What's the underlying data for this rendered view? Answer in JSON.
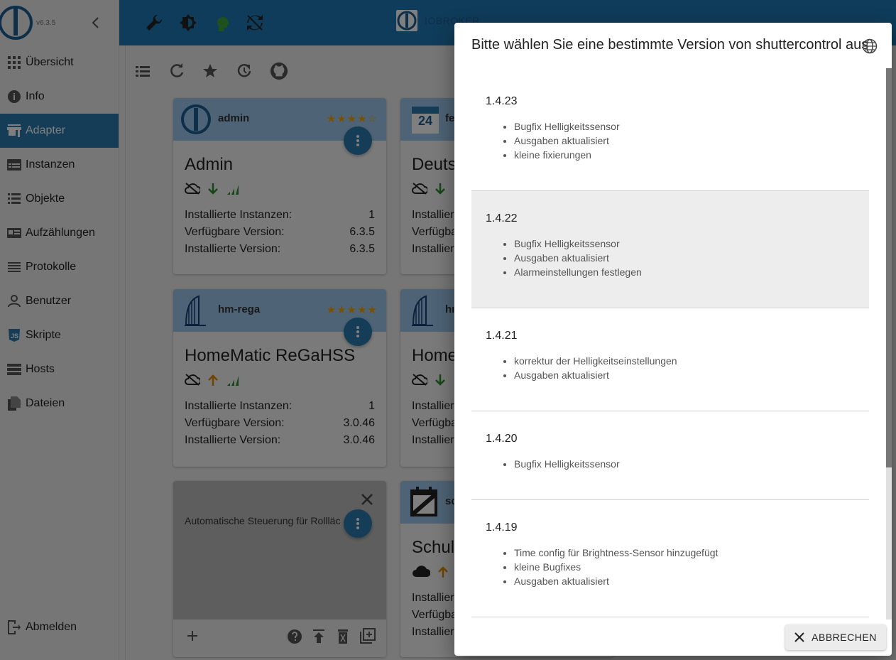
{
  "sidebar": {
    "version": "v6.3.5",
    "items": [
      {
        "label": "Übersicht",
        "icon": "apps-icon"
      },
      {
        "label": "Info",
        "icon": "info-icon"
      },
      {
        "label": "Adapter",
        "icon": "store-icon",
        "active": true
      },
      {
        "label": "Instanzen",
        "icon": "instances-icon"
      },
      {
        "label": "Objekte",
        "icon": "list-icon"
      },
      {
        "label": "Aufzählungen",
        "icon": "enum-icon"
      },
      {
        "label": "Protokolle",
        "icon": "log-icon"
      },
      {
        "label": "Benutzer",
        "icon": "user-icon"
      },
      {
        "label": "Skripte",
        "icon": "js-icon"
      },
      {
        "label": "Hosts",
        "icon": "hosts-icon"
      },
      {
        "label": "Dateien",
        "icon": "files-icon"
      }
    ],
    "logout": "Abmelden"
  },
  "topbar": {
    "brand": "IOBROKER",
    "accent": "#1f78b5"
  },
  "cards": [
    {
      "id": "admin",
      "title": "admin",
      "name": "Admin",
      "stars": "★★★★☆",
      "stats": [
        {
          "label": "Installierte Instanzen:",
          "value": "1"
        },
        {
          "label": "Verfügbare Version:",
          "value": "6.3.5"
        },
        {
          "label": "Installierte Version:",
          "value": "6.3.5"
        }
      ]
    },
    {
      "id": "feiertage",
      "title": "fe",
      "name": "Deuts",
      "logo_text": "24",
      "stats": [
        {
          "label": "Installier",
          "value": ""
        },
        {
          "label": "Verfügba",
          "value": ""
        },
        {
          "label": "Installier",
          "value": ""
        }
      ]
    },
    {
      "id": "hm-rega",
      "title": "hm-rega",
      "name": "HomeMatic ReGaHSS",
      "stars": "★★★★★",
      "stats": [
        {
          "label": "Installierte Instanzen:",
          "value": "1"
        },
        {
          "label": "Verfügbare Version:",
          "value": "3.0.46"
        },
        {
          "label": "Installierte Version:",
          "value": "3.0.46"
        }
      ]
    },
    {
      "id": "hm2",
      "title": "hı",
      "name": "Home",
      "stats": [
        {
          "label": "Installier",
          "value": ""
        },
        {
          "label": "Verfügba",
          "value": ""
        },
        {
          "label": "Installier",
          "value": ""
        }
      ]
    },
    {
      "id": "shuttercontrol",
      "description": "Automatische Steuerung für Rollläc"
    },
    {
      "id": "schoolfree",
      "title": "sc",
      "name": "Schul",
      "stats": [
        {
          "label": "Installier",
          "value": ""
        },
        {
          "label": "Verfügba",
          "value": ""
        },
        {
          "label": "Installier",
          "value": ""
        }
      ]
    }
  ],
  "dialog": {
    "title": "Bitte wählen Sie eine bestimmte Version von shuttercontrol aus",
    "versions": [
      {
        "version": "1.4.23",
        "notes": [
          "Bugfix Helligkeitssensor",
          "Ausgaben aktualisiert",
          "kleine fixierungen"
        ]
      },
      {
        "version": "1.4.22",
        "notes": [
          "Bugfix Helligkeitssensor",
          "Ausgaben aktualisiert",
          "Alarmeinstellungen festlegen"
        ],
        "highlighted": true
      },
      {
        "version": "1.4.21",
        "notes": [
          "korrektur der Helligkeitseinstellungen",
          "Ausgaben aktualisiert"
        ]
      },
      {
        "version": "1.4.20",
        "notes": [
          "Bugfix Helligkeitssensor"
        ]
      },
      {
        "version": "1.4.19",
        "notes": [
          "Time config für Brightness-Sensor hinzugefügt",
          "kleine Bugfixes",
          "Ausgaben aktualisiert"
        ]
      }
    ],
    "cancel_label": "ABBRECHEN"
  }
}
